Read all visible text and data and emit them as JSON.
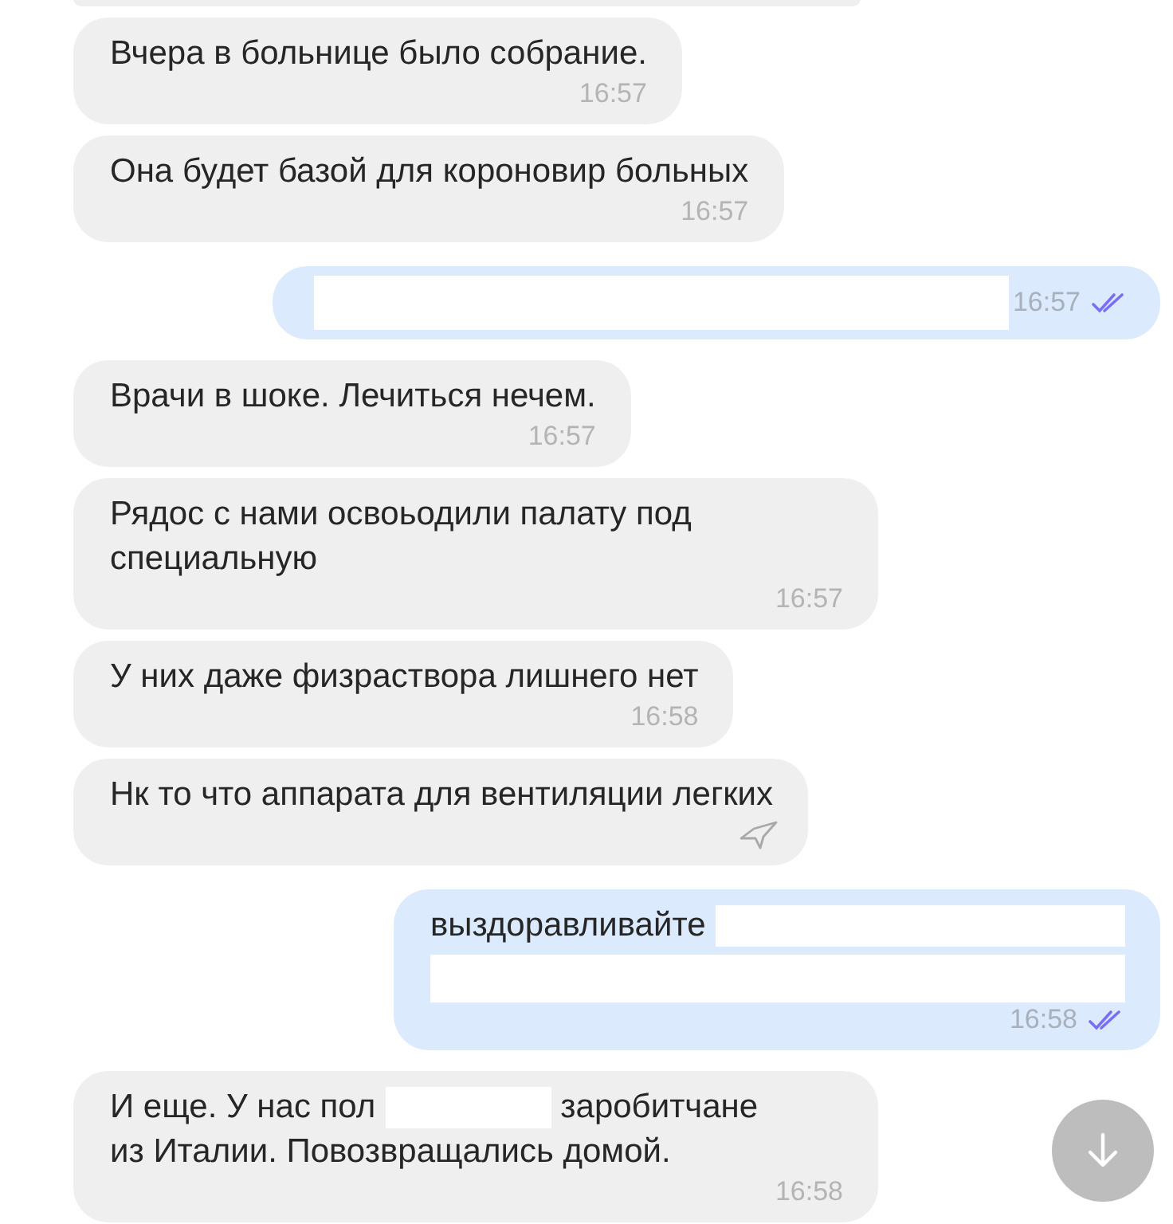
{
  "messages": [
    {
      "kind": "incoming",
      "parts": [
        {
          "kind": "text",
          "text": "Вчера в больнице было собрание."
        }
      ],
      "time": "16:57",
      "share_button": false
    },
    {
      "kind": "incoming",
      "parts": [
        {
          "kind": "text",
          "text": "Она будет базой для короновир больных"
        }
      ],
      "time": "16:57",
      "share_button": false
    },
    {
      "kind": "outgoing",
      "parts": [
        {
          "kind": "redaction"
        }
      ],
      "time": "16:57",
      "read": true,
      "share_button": false
    },
    {
      "kind": "incoming",
      "parts": [
        {
          "kind": "text",
          "text": "Врачи в шоке. Лечиться нечем."
        }
      ],
      "time": "16:57",
      "share_button": false
    },
    {
      "kind": "incoming",
      "parts": [
        {
          "kind": "text",
          "text": "Рядос с нами освоьодили палату под специальную"
        }
      ],
      "time": "16:57",
      "share_button": false
    },
    {
      "kind": "incoming",
      "parts": [
        {
          "kind": "text",
          "text": "У них даже физраствора лишнего нет"
        }
      ],
      "time": "16:58",
      "share_button": false
    },
    {
      "kind": "incoming",
      "parts": [
        {
          "kind": "text",
          "text": "Нк то что аппарата для вентиляции легких"
        }
      ],
      "share_button": true
    },
    {
      "kind": "outgoing",
      "parts": [
        {
          "kind": "text",
          "text": "выздоравливайте"
        },
        {
          "kind": "redaction"
        },
        {
          "kind": "redaction_line"
        }
      ],
      "time": "16:58",
      "read": true,
      "share_button": false
    },
    {
      "kind": "incoming",
      "parts": [
        {
          "kind": "text",
          "text": "И еще. У нас пол"
        },
        {
          "kind": "redaction"
        },
        {
          "kind": "text",
          "text": "заробитчане"
        },
        {
          "kind": "text",
          "text": "из Италии. Повозвращались домой."
        }
      ],
      "time": "16:58",
      "share_button": false
    }
  ]
}
